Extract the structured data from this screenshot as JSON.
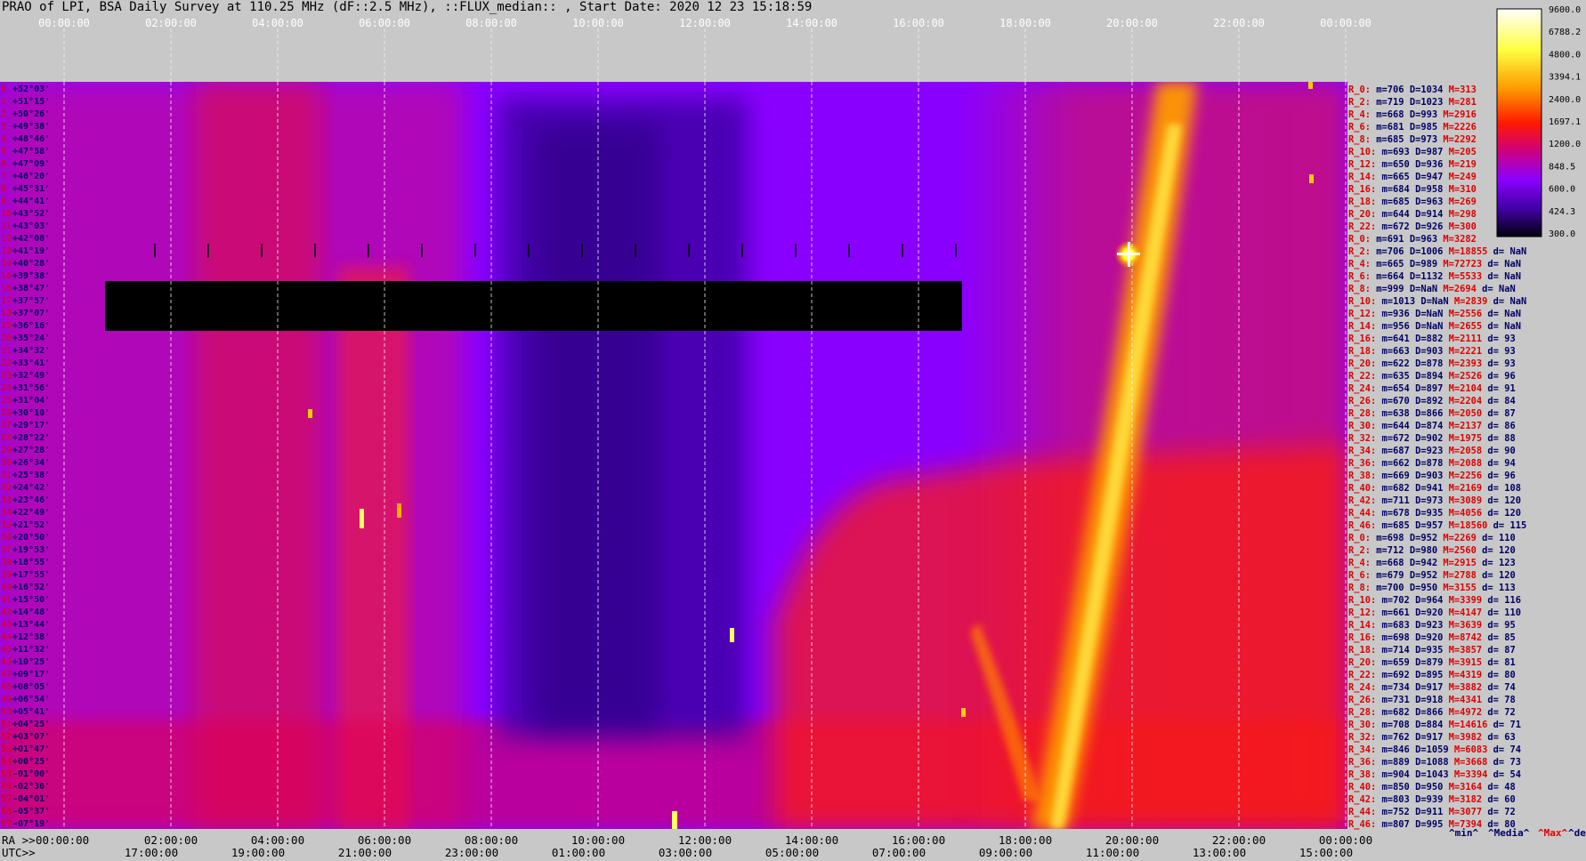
{
  "title": "PRAO of LPI, BSA Daily Survey at 110.25 MHz (dF::2.5 MHz), ::FLUX_median:: , Start Date: 2020 12 23 15:18:59",
  "chart_data": {
    "type": "heatmap",
    "title": "PRAO of LPI, BSA Daily Survey at 110.25 MHz (dF::2.5 MHz), ::FLUX_median:: , Start Date: 2020 12 23 15:18:59",
    "top_axis_ticks": [
      "00:00:00",
      "02:00:00",
      "04:00:00",
      "06:00:00",
      "08:00:00",
      "10:00:00",
      "12:00:00",
      "14:00:00",
      "16:00:00",
      "18:00:00",
      "20:00:00",
      "22:00:00",
      "00:00:00"
    ],
    "ra_axis_label": "RA >>",
    "ra_ticks": [
      "00:00:00",
      "02:00:00",
      "04:00:00",
      "06:00:00",
      "08:00:00",
      "10:00:00",
      "12:00:00",
      "14:00:00",
      "16:00:00",
      "18:00:00",
      "20:00:00",
      "22:00:00",
      "00:00:00"
    ],
    "utc_axis_label": "UTC>>",
    "utc_ticks": [
      "17:00:00",
      "19:00:00",
      "21:00:00",
      "23:00:00",
      "01:00:00",
      "03:00:00",
      "05:00:00",
      "07:00:00",
      "09:00:00",
      "11:00:00",
      "13:00:00",
      "15:00:00"
    ],
    "colorbar_ticks": [
      "9600.0",
      "6788.2",
      "4800.0",
      "3394.1",
      "2400.0",
      "1697.1",
      "1200.0",
      "848.5",
      "600.0",
      "424.3",
      "300.0"
    ],
    "declinations": [
      {
        "n": "0",
        "dec": "+52°03'"
      },
      {
        "n": "1",
        "dec": "+51°15'"
      },
      {
        "n": "2",
        "dec": "+50°26'"
      },
      {
        "n": "3",
        "dec": "+49°38'"
      },
      {
        "n": "4",
        "dec": "+48°46'"
      },
      {
        "n": "5",
        "dec": "+47°58'"
      },
      {
        "n": "6",
        "dec": "+47°09'"
      },
      {
        "n": "7",
        "dec": "+46°20'"
      },
      {
        "n": "8",
        "dec": "+45°31'"
      },
      {
        "n": "9",
        "dec": "+44°41'"
      },
      {
        "n": "10",
        "dec": "+43°52'"
      },
      {
        "n": "11",
        "dec": "+43°03'"
      },
      {
        "n": "12",
        "dec": "+42°08'"
      },
      {
        "n": "13",
        "dec": "+41°19'"
      },
      {
        "n": "14",
        "dec": "+40°28'"
      },
      {
        "n": "15",
        "dec": "+39°38'"
      },
      {
        "n": "16",
        "dec": "+38°47'"
      },
      {
        "n": "17",
        "dec": "+37°57'"
      },
      {
        "n": "18",
        "dec": "+37°07'"
      },
      {
        "n": "19",
        "dec": "+36°16'"
      },
      {
        "n": "20",
        "dec": "+35°24'"
      },
      {
        "n": "21",
        "dec": "+34°32'"
      },
      {
        "n": "22",
        "dec": "+33°41'"
      },
      {
        "n": "23",
        "dec": "+32°49'"
      },
      {
        "n": "24",
        "dec": "+31°56'"
      },
      {
        "n": "25",
        "dec": "+31°04'"
      },
      {
        "n": "26",
        "dec": "+30°10'"
      },
      {
        "n": "27",
        "dec": "+29°17'"
      },
      {
        "n": "28",
        "dec": "+28°22'"
      },
      {
        "n": "29",
        "dec": "+27°28'"
      },
      {
        "n": "30",
        "dec": "+26°34'"
      },
      {
        "n": "31",
        "dec": "+25°38'"
      },
      {
        "n": "32",
        "dec": "+24°42'"
      },
      {
        "n": "33",
        "dec": "+23°46'"
      },
      {
        "n": "34",
        "dec": "+22°49'"
      },
      {
        "n": "35",
        "dec": "+21°52'"
      },
      {
        "n": "36",
        "dec": "+20°50'"
      },
      {
        "n": "37",
        "dec": "+19°53'"
      },
      {
        "n": "38",
        "dec": "+18°55'"
      },
      {
        "n": "39",
        "dec": "+17°55'"
      },
      {
        "n": "40",
        "dec": "+16°52'"
      },
      {
        "n": "41",
        "dec": "+15°50'"
      },
      {
        "n": "42",
        "dec": "+14°48'"
      },
      {
        "n": "43",
        "dec": "+13°44'"
      },
      {
        "n": "44",
        "dec": "+12°38'"
      },
      {
        "n": "45",
        "dec": "+11°32'"
      },
      {
        "n": "46",
        "dec": "+10°25'"
      },
      {
        "n": "47",
        "dec": "+09°17'"
      },
      {
        "n": "48",
        "dec": "+08°05'"
      },
      {
        "n": "49",
        "dec": "+06°54'"
      },
      {
        "n": "50",
        "dec": "+05°41'"
      },
      {
        "n": "51",
        "dec": "+04°25'"
      },
      {
        "n": "52",
        "dec": "+03°07'"
      },
      {
        "n": "53",
        "dec": "+01°47'"
      },
      {
        "n": "54",
        "dec": "+00°25'"
      },
      {
        "n": "55",
        "dec": "-01°00'"
      },
      {
        "n": "56",
        "dec": "-02°30'"
      },
      {
        "n": "57",
        "dec": "-04°01'"
      },
      {
        "n": "58",
        "dec": "-05°37'"
      },
      {
        "n": "59",
        "dec": "-07°19'"
      }
    ],
    "stats": [
      [
        "R_0:",
        "706",
        "1034",
        "313",
        ""
      ],
      [
        "R_2:",
        "719",
        "1023",
        "281",
        ""
      ],
      [
        "R_4:",
        "668",
        "993",
        "2916",
        ""
      ],
      [
        "R_6:",
        "681",
        "985",
        "2226",
        ""
      ],
      [
        "R_8:",
        "685",
        "973",
        "2292",
        ""
      ],
      [
        "R_10:",
        "693",
        "987",
        "205",
        ""
      ],
      [
        "R_12:",
        "650",
        "936",
        "219",
        ""
      ],
      [
        "R_14:",
        "665",
        "947",
        "249",
        ""
      ],
      [
        "R_16:",
        "684",
        "958",
        "310",
        ""
      ],
      [
        "R_18:",
        "685",
        "963",
        "269",
        ""
      ],
      [
        "R_20:",
        "644",
        "914",
        "298",
        ""
      ],
      [
        "R_22:",
        "672",
        "926",
        "300",
        ""
      ],
      [
        "R_0:",
        "691",
        "963",
        "3282",
        ""
      ],
      [
        "R_2:",
        "706",
        "1006",
        "18855",
        "NaN"
      ],
      [
        "R_4:",
        "665",
        "989",
        "72723",
        "NaN"
      ],
      [
        "R_6:",
        "664",
        "1132",
        "5533",
        "NaN"
      ],
      [
        "R_8:",
        "999",
        "NaN",
        "2694",
        "NaN"
      ],
      [
        "R_10:",
        "1013",
        "NaN",
        "2839",
        "NaN"
      ],
      [
        "R_12:",
        "936",
        "NaN",
        "2556",
        "NaN"
      ],
      [
        "R_14:",
        "956",
        "NaN",
        "2655",
        "NaN"
      ],
      [
        "R_16:",
        "641",
        "882",
        "2111",
        "93"
      ],
      [
        "R_18:",
        "663",
        "903",
        "2221",
        "93"
      ],
      [
        "R_20:",
        "622",
        "878",
        "2393",
        "93"
      ],
      [
        "R_22:",
        "635",
        "894",
        "2526",
        "96"
      ],
      [
        "R_24:",
        "654",
        "897",
        "2104",
        "91"
      ],
      [
        "R_26:",
        "670",
        "892",
        "2204",
        "84"
      ],
      [
        "R_28:",
        "638",
        "866",
        "2050",
        "87"
      ],
      [
        "R_30:",
        "644",
        "874",
        "2137",
        "86"
      ],
      [
        "R_32:",
        "672",
        "902",
        "1975",
        "88"
      ],
      [
        "R_34:",
        "687",
        "923",
        "2058",
        "90"
      ],
      [
        "R_36:",
        "662",
        "878",
        "2088",
        "94"
      ],
      [
        "R_38:",
        "669",
        "903",
        "2256",
        "96"
      ],
      [
        "R_40:",
        "682",
        "941",
        "2169",
        "108"
      ],
      [
        "R_42:",
        "711",
        "973",
        "3089",
        "120"
      ],
      [
        "R_44:",
        "678",
        "935",
        "4056",
        "120"
      ],
      [
        "R_46:",
        "685",
        "957",
        "18560",
        "115"
      ],
      [
        "R_0:",
        "698",
        "952",
        "2269",
        "110"
      ],
      [
        "R_2:",
        "712",
        "980",
        "2560",
        "120"
      ],
      [
        "R_4:",
        "668",
        "942",
        "2915",
        "123"
      ],
      [
        "R_6:",
        "679",
        "952",
        "2788",
        "120"
      ],
      [
        "R_8:",
        "700",
        "950",
        "3155",
        "113"
      ],
      [
        "R_10:",
        "702",
        "964",
        "3399",
        "116"
      ],
      [
        "R_12:",
        "661",
        "920",
        "4147",
        "110"
      ],
      [
        "R_14:",
        "683",
        "923",
        "3639",
        "95"
      ],
      [
        "R_16:",
        "698",
        "920",
        "8742",
        "85"
      ],
      [
        "R_18:",
        "714",
        "935",
        "3857",
        "87"
      ],
      [
        "R_20:",
        "659",
        "879",
        "3915",
        "81"
      ],
      [
        "R_22:",
        "692",
        "895",
        "4319",
        "80"
      ],
      [
        "R_24:",
        "734",
        "917",
        "3882",
        "74"
      ],
      [
        "R_26:",
        "731",
        "918",
        "4341",
        "78"
      ],
      [
        "R_28:",
        "682",
        "866",
        "4972",
        "72"
      ],
      [
        "R_30:",
        "708",
        "884",
        "14616",
        "71"
      ],
      [
        "R_32:",
        "762",
        "917",
        "3982",
        "63"
      ],
      [
        "R_34:",
        "846",
        "1059",
        "6083",
        "74"
      ],
      [
        "R_36:",
        "889",
        "1088",
        "3668",
        "73"
      ],
      [
        "R_38:",
        "904",
        "1043",
        "3394",
        "54"
      ],
      [
        "R_40:",
        "850",
        "950",
        "3164",
        "48"
      ],
      [
        "R_42:",
        "803",
        "939",
        "3182",
        "60"
      ],
      [
        "R_44:",
        "752",
        "911",
        "3077",
        "72"
      ],
      [
        "R_46:",
        "807",
        "995",
        "7394",
        "80"
      ]
    ],
    "footer_labels": {
      "min": "^min^",
      "median": "^Media^",
      "max": "^Max^",
      "devia": "^devia^"
    }
  },
  "colors": {
    "background": "#c8c8c8",
    "plot_base": "#8a00ff",
    "label_red": "#e00000",
    "label_navy": "#000066"
  }
}
